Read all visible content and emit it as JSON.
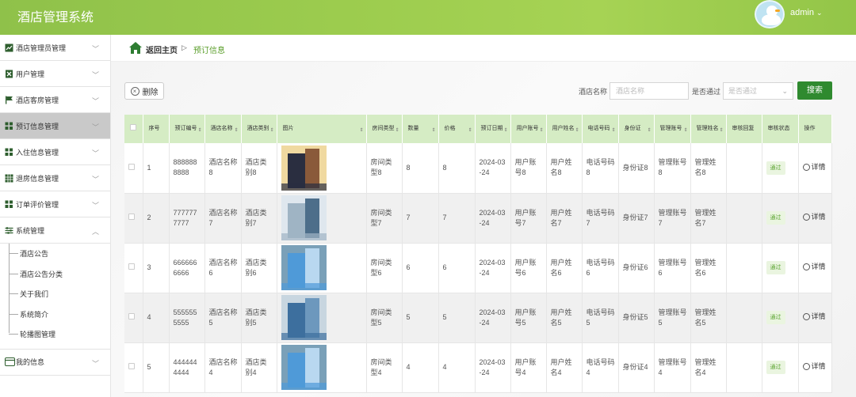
{
  "app": {
    "title": "酒店管理系统",
    "user": "admin"
  },
  "sidebar": {
    "items": [
      {
        "label": "酒店管理员管理",
        "icon": "chart-icon"
      },
      {
        "label": "用户管理",
        "icon": "excel-icon"
      },
      {
        "label": "酒店客房管理",
        "icon": "flag-icon"
      },
      {
        "label": "预订信息管理",
        "icon": "grid-icon",
        "active": true
      },
      {
        "label": "入住信息管理",
        "icon": "grid-icon"
      },
      {
        "label": "退房信息管理",
        "icon": "table-icon"
      },
      {
        "label": "订单评价管理",
        "icon": "grid-icon"
      },
      {
        "label": "系统管理",
        "icon": "sliders-icon",
        "expanded": true
      },
      {
        "label": "我的信息",
        "icon": "card-icon"
      }
    ],
    "sub_items": [
      "酒店公告",
      "酒店公告分类",
      "关于我们",
      "系统简介",
      "轮播图管理"
    ]
  },
  "breadcrumb": {
    "home": "返回主页",
    "sep": "▷",
    "current": "预订信息"
  },
  "toolbar": {
    "delete_label": "删除",
    "filter1_label": "酒店名称",
    "filter1_placeholder": "酒店名称",
    "filter2_label": "是否通过",
    "filter2_placeholder": "是否通过",
    "search_label": "搜索"
  },
  "table": {
    "headers": [
      "序号",
      "预订编号",
      "酒店名称",
      "酒店类别",
      "图片",
      "房间类型",
      "数量",
      "价格",
      "预订日期",
      "用户账号",
      "用户姓名",
      "电话号码",
      "身份证",
      "管理账号",
      "管理姓名",
      "审核回复",
      "审核状态",
      "操作"
    ],
    "rows": [
      {
        "no": "1",
        "code": "8888888888",
        "hotel": "酒店名称8",
        "category": "酒店类别8",
        "room": "房间类型8",
        "qty": "8",
        "price": "8",
        "date": "2024-03-24",
        "account": "用户账号8",
        "name": "用户姓名8",
        "phone": "电话号码8",
        "id": "身份证8",
        "admin_acc": "管理账号8",
        "admin_name": "管理姓名8",
        "reply": "",
        "status": "通过",
        "action": "详情",
        "img": [
          "#2a2e40",
          "#8a5a3a",
          "#f0d9a0"
        ]
      },
      {
        "no": "2",
        "code": "7777777777",
        "hotel": "酒店名称7",
        "category": "酒店类别7",
        "room": "房间类型7",
        "qty": "7",
        "price": "7",
        "date": "2024-03-24",
        "account": "用户账号7",
        "name": "用户姓名7",
        "phone": "电话号码7",
        "id": "身份证7",
        "admin_acc": "管理账号7",
        "admin_name": "管理姓名7",
        "reply": "",
        "status": "通过",
        "action": "详情",
        "img": [
          "#9fb4c4",
          "#4d6e8a",
          "#dfe7ee"
        ]
      },
      {
        "no": "3",
        "code": "6666666666",
        "hotel": "酒店名称6",
        "category": "酒店类别6",
        "room": "房间类型6",
        "qty": "6",
        "price": "6",
        "date": "2024-03-24",
        "account": "用户账号6",
        "name": "用户姓名6",
        "phone": "电话号码6",
        "id": "身份证6",
        "admin_acc": "管理账号6",
        "admin_name": "管理姓名6",
        "reply": "",
        "status": "通过",
        "action": "详情",
        "img": [
          "#4f9ad8",
          "#b9d8f0",
          "#7aa0b8"
        ]
      },
      {
        "no": "4",
        "code": "5555555555",
        "hotel": "酒店名称5",
        "category": "酒店类别5",
        "room": "房间类型5",
        "qty": "5",
        "price": "5",
        "date": "2024-03-24",
        "account": "用户账号5",
        "name": "用户姓名5",
        "phone": "电话号码5",
        "id": "身份证5",
        "admin_acc": "管理账号5",
        "admin_name": "管理姓名5",
        "reply": "",
        "status": "通过",
        "action": "详情",
        "img": [
          "#3d6f9e",
          "#6d98bd",
          "#c8d6e0"
        ]
      },
      {
        "no": "5",
        "code": "4444444444",
        "hotel": "酒店名称4",
        "category": "酒店类别4",
        "room": "房间类型4",
        "qty": "4",
        "price": "4",
        "date": "2024-03-24",
        "account": "用户账号4",
        "name": "用户姓名4",
        "phone": "电话号码4",
        "id": "身份证4",
        "admin_acc": "管理账号4",
        "admin_name": "管理姓名4",
        "reply": "",
        "status": "通过",
        "action": "详情",
        "img": [
          "#4f9ad8",
          "#b9d8f0",
          "#7aa0b8"
        ]
      }
    ]
  },
  "colors": {
    "accent": "#9ccc4e",
    "header_row": "#d5ecc4",
    "search_button": "#2f8a2f",
    "active_menu": "#c9c9c9"
  }
}
